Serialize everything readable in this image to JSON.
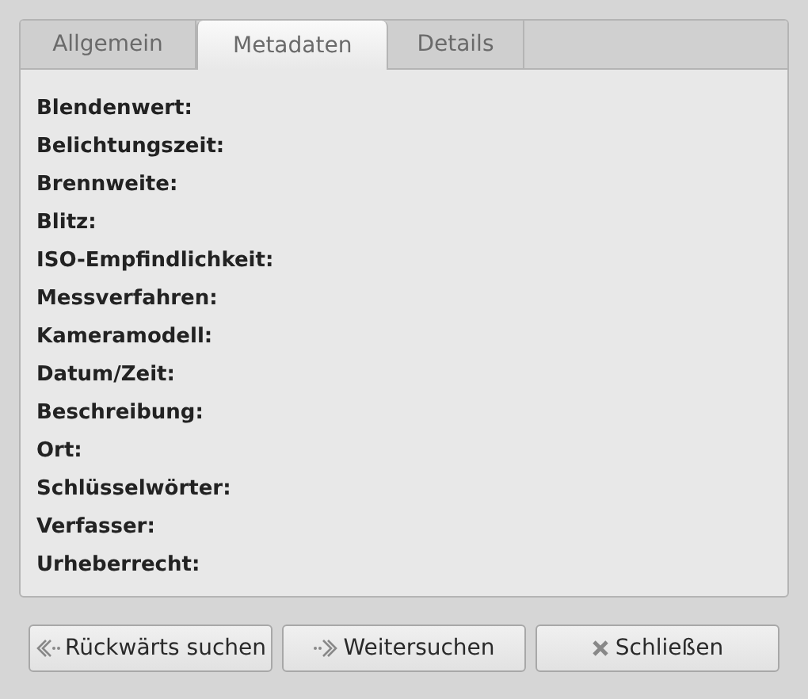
{
  "tabs": [
    {
      "label": "Allgemein",
      "selected": false
    },
    {
      "label": "Metadaten",
      "selected": true
    },
    {
      "label": "Details",
      "selected": false
    }
  ],
  "fields": [
    "Blendenwert:",
    "Belichtungszeit:",
    "Brennweite:",
    "Blitz:",
    "ISO-Empfindlichkeit:",
    "Messverfahren:",
    "Kameramodell:",
    "Datum/Zeit:",
    "Beschreibung:",
    "Ort:",
    "Schlüsselwörter:",
    "Verfasser:",
    "Urheberrecht:"
  ],
  "buttons": [
    {
      "label": "Rückwärts suchen",
      "kind": "back"
    },
    {
      "label": "Weitersuchen",
      "kind": "forward"
    },
    {
      "label": "Schließen",
      "kind": "close"
    }
  ]
}
